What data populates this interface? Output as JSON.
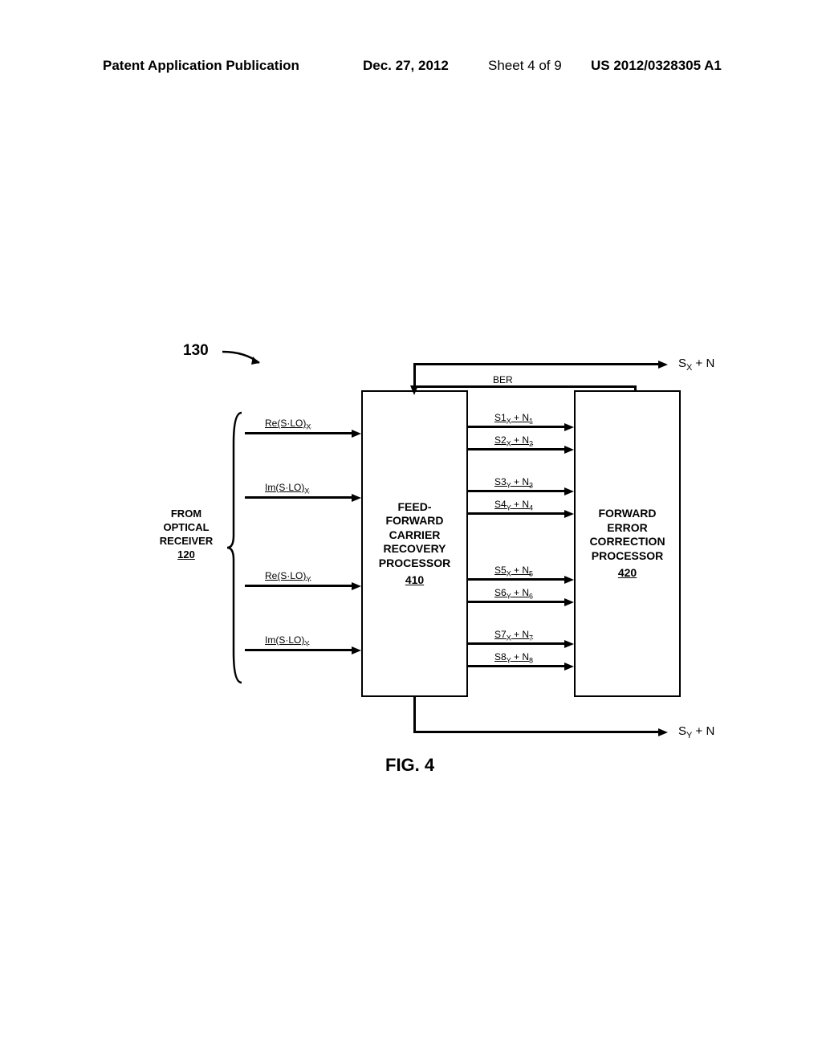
{
  "header": {
    "pub_label": "Patent Application Publication",
    "date": "Dec. 27, 2012",
    "sheet": "Sheet 4 of 9",
    "pub_num": "US 2012/0328305 A1"
  },
  "ref_num": "130",
  "from_label": {
    "line1": "FROM",
    "line2": "OPTICAL",
    "line3": "RECEIVER",
    "num": "120"
  },
  "box_410": {
    "line1": "FEED-",
    "line2": "FORWARD",
    "line3": "CARRIER",
    "line4": "RECOVERY",
    "line5": "PROCESSOR",
    "num": "410"
  },
  "box_420": {
    "line1": "FORWARD",
    "line2": "ERROR",
    "line3": "CORRECTION",
    "line4": "PROCESSOR",
    "num": "420"
  },
  "inputs": {
    "i1": "Re(S·LO)ₓ",
    "i2": "Im(S·LO)ₓ",
    "i3": "Re(S·LO)ᵧ",
    "i4": "Im(S·LO)ᵧ"
  },
  "inputs_html": {
    "i1": "Re(S·LO)<sub>X</sub>",
    "i2": "Im(S·LO)<sub>X</sub>",
    "i3": "Re(S·LO)<sub>Y</sub>",
    "i4": "Im(S·LO)<sub>Y</sub>"
  },
  "mid_signals": {
    "s1": "S1<sub>X</sub> + N<sub>1</sub>",
    "s2": "S2<sub>X</sub> + N<sub>2</sub>",
    "s3": "S3<sub>Y</sub> + N<sub>3</sub>",
    "s4": "S4<sub>Y</sub> + N<sub>4</sub>",
    "s5": "S5<sub>X</sub> + N<sub>5</sub>",
    "s6": "S6<sub>Y</sub> + N<sub>6</sub>",
    "s7": "S7<sub>X</sub> + N<sub>7</sub>",
    "s8": "S8<sub>Y</sub> + N<sub>8</sub>"
  },
  "ber": "BER",
  "outputs": {
    "top": "S<sub>X</sub> + N",
    "bottom": "S<sub>Y</sub> + N"
  },
  "fig_caption": "FIG. 4",
  "chart_data": {
    "type": "diagram",
    "title": "FIG. 4",
    "reference_number": "130",
    "blocks": [
      {
        "id": "410",
        "name": "FEED-FORWARD CARRIER RECOVERY PROCESSOR",
        "inputs": [
          "Re(S·LO)_X",
          "Im(S·LO)_X",
          "Re(S·LO)_Y",
          "Im(S·LO)_Y",
          "BER"
        ],
        "outputs": [
          "S1_X + N_1",
          "S2_X + N_2",
          "S3_Y + N_3",
          "S4_Y + N_4",
          "S5_X + N_5",
          "S6_Y + N_6",
          "S7_X + N_7",
          "S8_Y + N_8",
          "S_X + N",
          "S_Y + N"
        ]
      },
      {
        "id": "420",
        "name": "FORWARD ERROR CORRECTION PROCESSOR",
        "inputs": [
          "S1_X + N_1",
          "S2_X + N_2",
          "S3_Y + N_3",
          "S4_Y + N_4",
          "S5_X + N_5",
          "S6_Y + N_6",
          "S7_X + N_7",
          "S8_Y + N_8"
        ],
        "outputs": [
          "BER"
        ]
      }
    ],
    "input_source": "FROM OPTICAL RECEIVER 120"
  }
}
